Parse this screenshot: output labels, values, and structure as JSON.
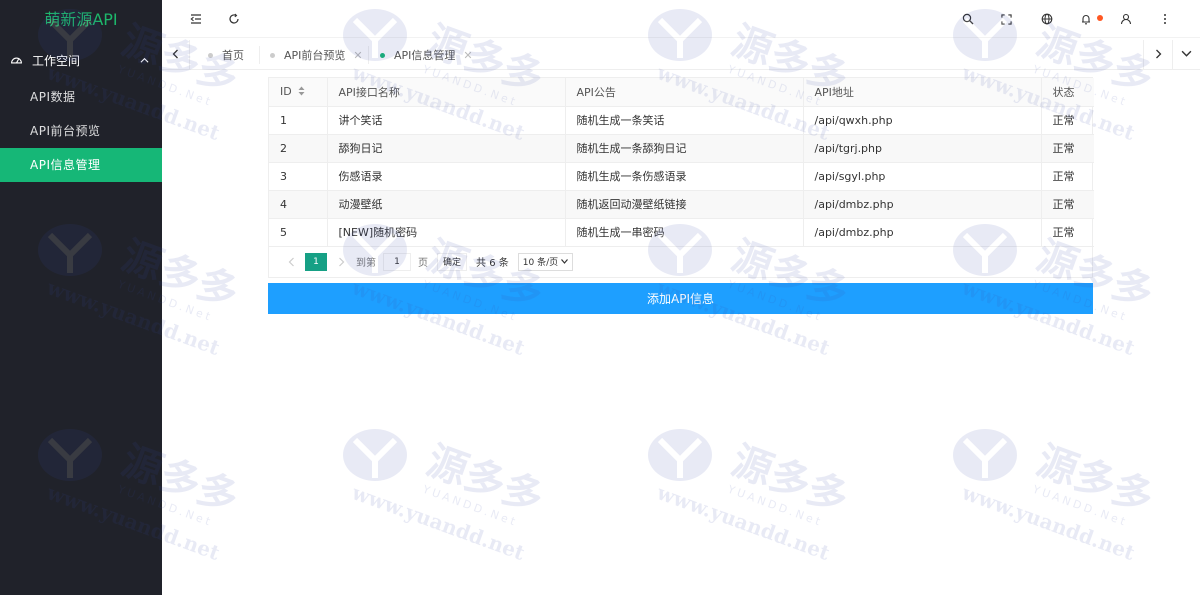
{
  "sidebar": {
    "logo": "萌新源API",
    "group_label": "工作空间",
    "items": [
      {
        "label": "API数据"
      },
      {
        "label": "API前台预览"
      },
      {
        "label": "API信息管理"
      }
    ]
  },
  "tabs": [
    {
      "label": "首页"
    },
    {
      "label": "API前台预览"
    },
    {
      "label": "API信息管理"
    }
  ],
  "table": {
    "headers": [
      "ID",
      "API接口名称",
      "API公告",
      "API地址",
      "状态"
    ],
    "rows": [
      {
        "id": "1",
        "name": "讲个笑话",
        "notice": "随机生成一条笑话",
        "url": "/api/qwxh.php",
        "status": "正常"
      },
      {
        "id": "2",
        "name": "舔狗日记",
        "notice": "随机生成一条舔狗日记",
        "url": "/api/tgrj.php",
        "status": "正常"
      },
      {
        "id": "3",
        "name": "伤感语录",
        "notice": "随机生成一条伤感语录",
        "url": "/api/sgyl.php",
        "status": "正常"
      },
      {
        "id": "4",
        "name": "动漫壁纸",
        "notice": "随机返回动漫壁纸链接",
        "url": "/api/dmbz.php",
        "status": "正常"
      },
      {
        "id": "5",
        "name": "[NEW]随机密码",
        "notice": "随机生成一串密码",
        "url": "/api/dmbz.php",
        "status": "正常"
      }
    ]
  },
  "pager": {
    "current": "1",
    "goto_label": "到第",
    "goto_value": "1",
    "page_label": "页",
    "confirm": "确定",
    "total": "共 6 条",
    "page_size": "10 条/页"
  },
  "add_button": "添加API信息",
  "watermark": {
    "brand": "源多多",
    "sub": "YUANDD.Net",
    "url": "www.yuandd.net"
  },
  "colors": {
    "sidebar_bg": "#20222a",
    "accent": "#16b777",
    "primary_button": "#1e9fff",
    "notification_dot": "#ff5722"
  }
}
